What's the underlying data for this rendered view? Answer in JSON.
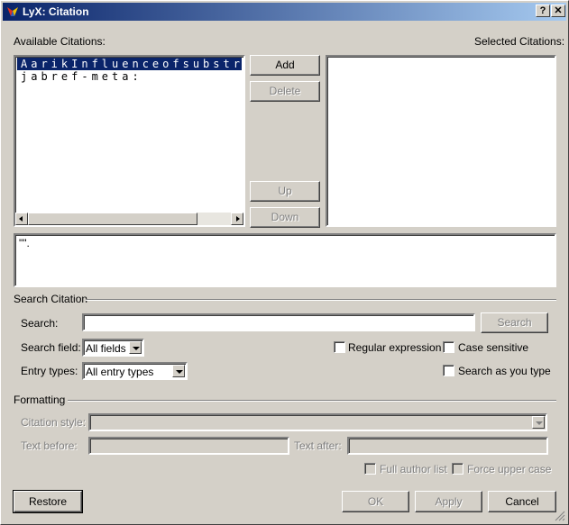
{
  "window": {
    "title": "LyX: Citation",
    "help_label": "?",
    "close_label": "✕"
  },
  "available": {
    "label": "Available Citations:",
    "items": [
      "AarikInfluenceofsubstra",
      "jabref-meta:"
    ],
    "selected_index": 0
  },
  "selected": {
    "label": "Selected Citations:"
  },
  "buttons": {
    "add": "Add",
    "delete": "Delete",
    "up": "Up",
    "down": "Down",
    "search": "Search",
    "restore": "Restore",
    "ok": "OK",
    "apply": "Apply",
    "cancel": "Cancel"
  },
  "info_text": "\"\".",
  "search_citation": {
    "group_title": "Search Citation",
    "search_label": "Search:",
    "search_value": "",
    "search_field_label": "Search field:",
    "search_field_value": "All fields",
    "entry_types_label": "Entry types:",
    "entry_types_value": "All entry types",
    "regex_label": "Regular expression",
    "case_label": "Case sensitive",
    "as_you_type_label": "Search as you type"
  },
  "formatting": {
    "group_title": "Formatting",
    "citation_style_label": "Citation style:",
    "citation_style_value": "",
    "text_before_label": "Text before:",
    "text_before_value": "",
    "text_after_label": "Text after:",
    "text_after_value": "",
    "full_author_label": "Full author list",
    "force_upper_label": "Force upper case"
  },
  "colors": {
    "titlebar_start": "#0a246a",
    "titlebar_end": "#a6caf0",
    "face": "#d4d0c8",
    "selection": "#0a246a"
  }
}
